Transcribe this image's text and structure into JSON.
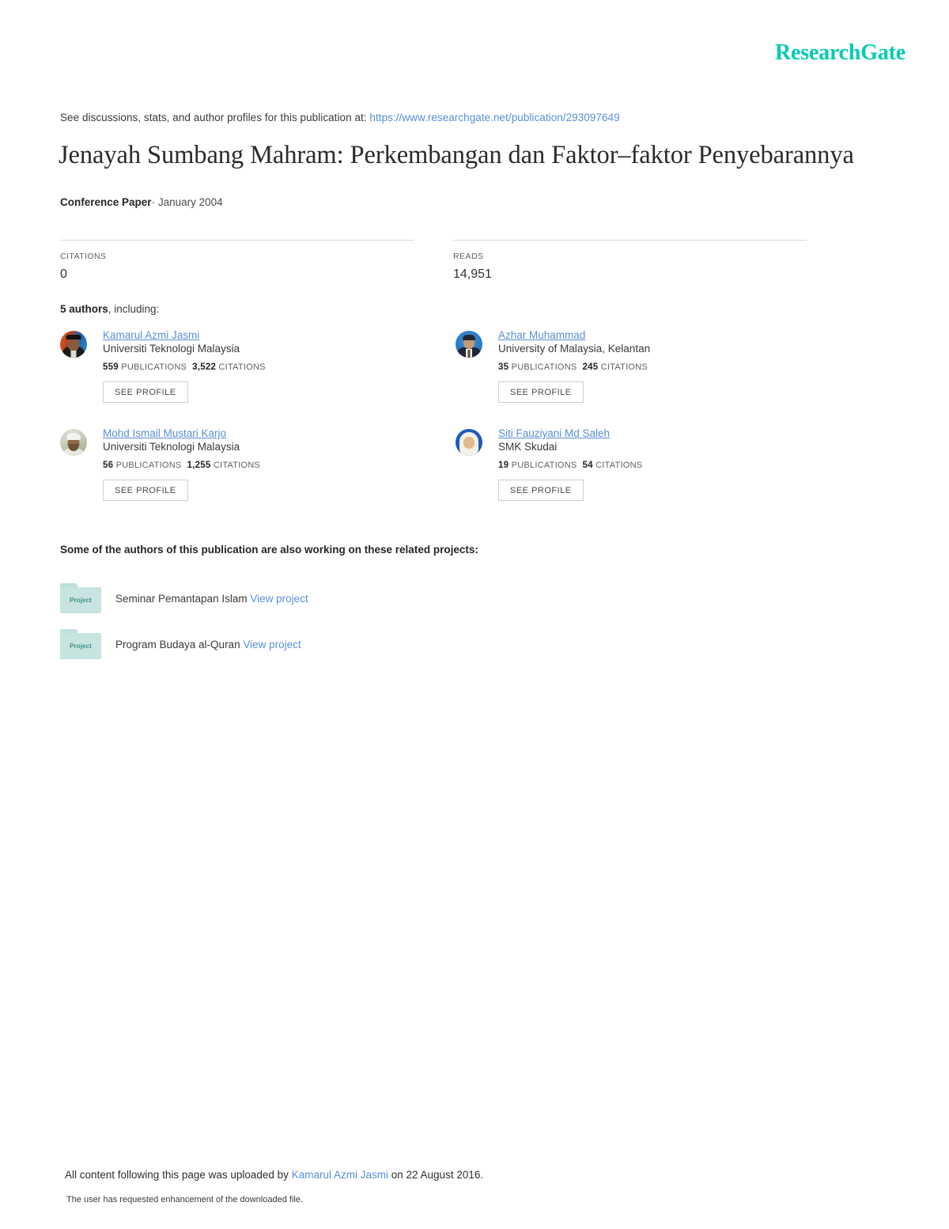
{
  "brand": {
    "name": "ResearchGate",
    "color": "#00ccb1"
  },
  "header": {
    "discussion_prefix": "See discussions, stats, and author profiles for this publication at:",
    "publication_url": "https://www.researchgate.net/publication/293097649"
  },
  "publication": {
    "title": "Jenayah Sumbang Mahram: Perkembangan dan Faktor–faktor Penyebarannya",
    "type": "Conference Paper",
    "separator": "·",
    "date": "January 2004"
  },
  "metrics": [
    {
      "label": "CITATIONS",
      "value": "0"
    },
    {
      "label": "READS",
      "value": "14,951"
    }
  ],
  "authors_section": {
    "count_text": "5 authors",
    "including_text": ", including:",
    "publications_label": "PUBLICATIONS",
    "citations_label": "CITATIONS",
    "see_profile_label": "SEE PROFILE"
  },
  "authors": [
    {
      "name": "Kamarul Azmi Jasmi",
      "affiliation": "Universiti Teknologi Malaysia",
      "publications": "559",
      "citations": "3,522",
      "avatar": "avatar-kamarul-azmi-jasmi"
    },
    {
      "name": "Azhar Muhammad",
      "affiliation": "University of Malaysia, Kelantan",
      "publications": "35",
      "citations": "245",
      "avatar": "avatar-azhar-muhammad"
    },
    {
      "name": "Mohd Ismail Mustari Karjo",
      "affiliation": "Universiti Teknologi Malaysia",
      "publications": "56",
      "citations": "1,255",
      "avatar": "avatar-mohd-ismail-mustari-karjo"
    },
    {
      "name": "Siti Fauziyani Md Saleh",
      "affiliation": "SMK Skudai",
      "publications": "19",
      "citations": "54",
      "avatar": "avatar-siti-fauziyani-md-saleh"
    }
  ],
  "projects_section": {
    "heading": "Some of the authors of this publication are also working on these related projects:",
    "folder_glyph_label": "Project",
    "view_project_label": "View project"
  },
  "projects": [
    {
      "title": "Seminar Pemantapan Islam"
    },
    {
      "title": "Program Budaya al-Quran"
    }
  ],
  "footer": {
    "upload_prefix": "All content following this page was uploaded by",
    "uploader": "Kamarul Azmi Jasmi",
    "upload_suffix": "on 22 August 2016.",
    "note": "The user has requested enhancement of the downloaded file."
  }
}
